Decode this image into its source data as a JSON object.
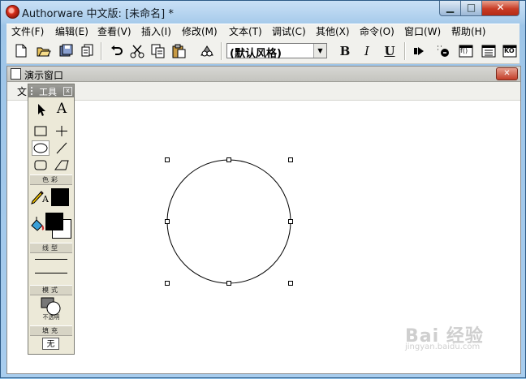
{
  "window": {
    "title": "Authorware 中文版: [未命名] *",
    "controls": {
      "minimize": "▁",
      "maximize": "□",
      "close": "✕"
    }
  },
  "menubar": {
    "items": [
      "文件(F)",
      "编辑(E)",
      "查看(V)",
      "插入(I)",
      "修改(M)",
      "文本(T)",
      "调试(C)",
      "其他(X)",
      "命令(O)",
      "窗口(W)",
      "帮助(H)"
    ]
  },
  "toolbar": {
    "icons": [
      "new-file-icon",
      "open-file-icon",
      "save-all-icon",
      "import-icon",
      "undo-icon",
      "cut-icon",
      "copy-icon",
      "paste-icon",
      "find-icon",
      "bold-icon",
      "italic-icon",
      "underline-icon",
      "run-icon",
      "control-panel-icon",
      "functions-icon",
      "variables-icon",
      "knowledge-objects-icon"
    ],
    "style_value": "(默认风格)",
    "bold": "B",
    "italic": "I",
    "underline": "U",
    "fn_label": "f()",
    "ko_label": "KO"
  },
  "presentation": {
    "title": "演示窗口",
    "close": "✕",
    "menu": "文"
  },
  "tools": {
    "title": "工具",
    "close": "x",
    "text_tool": "A",
    "pen_letter": "A",
    "sections": {
      "color": "色彩",
      "line": "线型",
      "mode": "模式",
      "fill": "填充"
    },
    "mode_value": "不透明",
    "fill_value": "无",
    "selected_tool": "ellipse",
    "stroke_color": "#000000",
    "fill_color": "#000000"
  },
  "watermark": {
    "main": "Bai 经验",
    "sub": "jingyan.baidu.com"
  },
  "colors": {
    "window_frame": "#a9cceb",
    "menubar": "#f1f1ed",
    "close_button": "#c83c26",
    "canvas": "#ffffff"
  }
}
